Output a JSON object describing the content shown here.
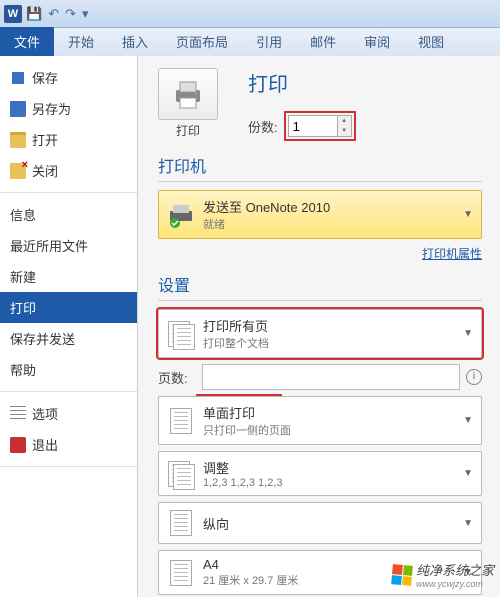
{
  "titlebar": {
    "app_letter": "W"
  },
  "ribbon": {
    "tabs": [
      "文件",
      "开始",
      "插入",
      "页面布局",
      "引用",
      "邮件",
      "审阅",
      "视图"
    ],
    "active": 0
  },
  "sidebar": {
    "quick": [
      {
        "icon": "save",
        "label": "保存"
      },
      {
        "icon": "saveas",
        "label": "另存为"
      },
      {
        "icon": "open",
        "label": "打开"
      },
      {
        "icon": "close",
        "label": "关闭"
      }
    ],
    "main": [
      "信息",
      "最近所用文件",
      "新建",
      "打印",
      "保存并发送",
      "帮助"
    ],
    "active_main": "打印",
    "footer": [
      {
        "icon": "options",
        "label": "选项"
      },
      {
        "icon": "exit",
        "label": "退出"
      }
    ]
  },
  "print": {
    "header_title": "打印",
    "button_label": "打印",
    "copies_label": "份数:",
    "copies_value": "1",
    "printer_section": "打印机",
    "printer": {
      "name": "发送至 OneNote 2010",
      "status": "就绪"
    },
    "printer_props": "打印机属性",
    "settings_section": "设置",
    "range": {
      "title": "打印所有页",
      "sub": "打印整个文档"
    },
    "pages_label": "页数:",
    "pages_value": "",
    "duplex": {
      "title": "单面打印",
      "sub": "只打印一侧的页面"
    },
    "collate": {
      "title": "调整",
      "sub": "1,2,3   1,2,3   1,2,3"
    },
    "orientation": {
      "title": "纵向"
    },
    "paper": {
      "title": "A4",
      "sub": "21 厘米 x 29.7 厘米"
    }
  },
  "watermark": {
    "text": "纯净系统之家",
    "url": "www.ycwjzy.com"
  }
}
